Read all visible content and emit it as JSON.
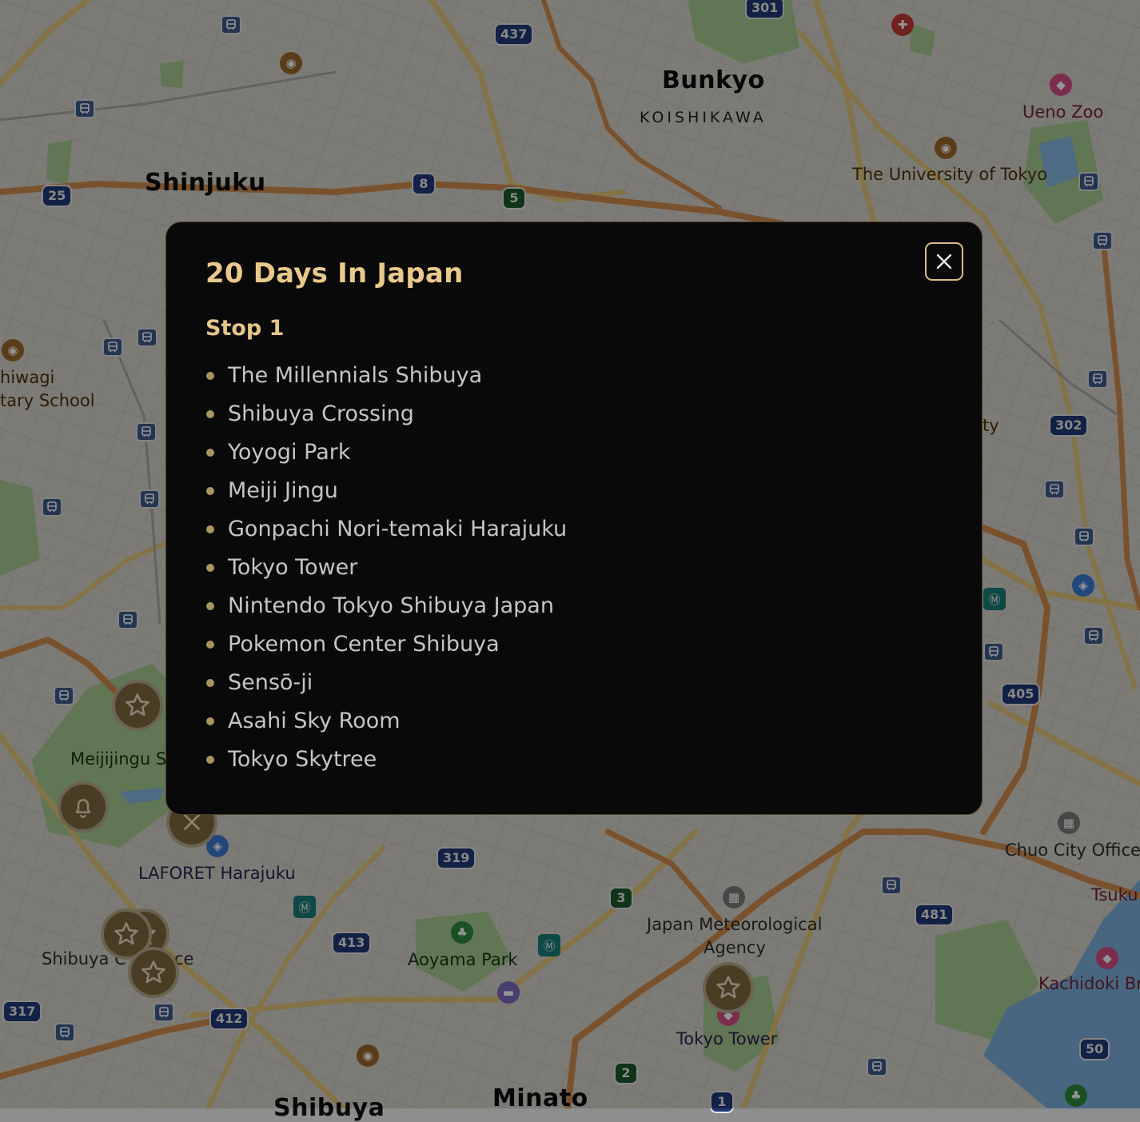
{
  "map": {
    "area_labels": {
      "bunkyo": "Bunkyo",
      "koishikawa": "KOISHIKAWA",
      "shinjuku": "Shinjuku",
      "minato": "Minato",
      "shibuya": "Shibuya"
    },
    "poi_labels": {
      "ueno_zoo": "Ueno Zoo",
      "university_of_tokyo": "The University of Tokyo",
      "kashiwagi_school_line1": "hiwagi",
      "kashiwagi_school_line2": "tary School",
      "meijijingu": "Meijijingu S",
      "laforet_harajuku": "LAFORET Harajuku",
      "aoyama_park": "Aoyama Park",
      "japan_meteorological_agency_line1": "Japan Meteorological",
      "japan_meteorological_agency_line2": "Agency",
      "tokyo_tower": "Tokyo Tower",
      "shibuya_city_office": "Shibuya C",
      "shibuya_city_office_end": "ce",
      "chuo_city_office": "Chuo City Office",
      "tsuki": "Tsuku",
      "kachidoki": "Kachidoki Br",
      "partial_ty": "ty"
    },
    "route_shields": [
      "301",
      "437",
      "25",
      "8",
      "5",
      "302",
      "405",
      "319",
      "3",
      "481",
      "413",
      "412",
      "317",
      "2",
      "50",
      "1"
    ]
  },
  "modal": {
    "title": "20 Days In Japan",
    "stop_heading": "Stop 1",
    "stops": [
      "The Millennials Shibuya",
      "Shibuya Crossing",
      "Yoyogi Park",
      "Meiji Jingu",
      "Gonpachi Nori-temaki Harajuku",
      "Tokyo Tower",
      "Nintendo Tokyo Shibuya Japan",
      "Pokemon Center Shibuya",
      "Sensō-ji",
      "Asahi Sky Room",
      "Tokyo Skytree"
    ],
    "close_icon": "close-icon"
  },
  "colors": {
    "accent_gold": "#e9c98b",
    "modal_background": "#090909",
    "list_text": "#c5c5c5",
    "bullet": "#a89563"
  }
}
